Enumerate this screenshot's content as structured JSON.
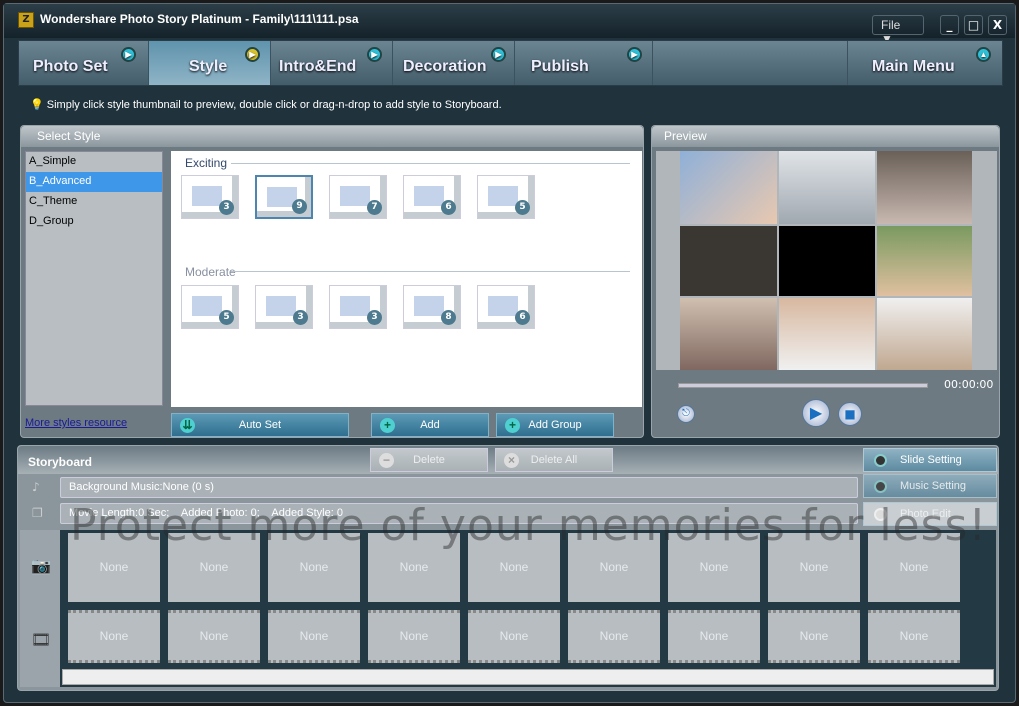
{
  "window": {
    "title": "Wondershare Photo Story Platinum - Family\\111\\111.psa",
    "file_menu": "File ▼",
    "minimize": "_",
    "maximize": "□",
    "close": "X"
  },
  "tabs": [
    {
      "label": "Photo Set",
      "active": false
    },
    {
      "label": "Style",
      "active": true
    },
    {
      "label": "Intro&End",
      "active": false
    },
    {
      "label": "Decoration",
      "active": false
    },
    {
      "label": "Publish",
      "active": false
    },
    {
      "label": "Main Menu",
      "active": false
    }
  ],
  "hint": "Simply click style thumbnail to preview, double click or drag-n-drop to add style to Storyboard.",
  "select_style": {
    "title": "Select Style",
    "categories": [
      "A_Simple",
      "B_Advanced",
      "C_Theme",
      "D_Group"
    ],
    "selected": "B_Advanced",
    "groups": [
      {
        "name": "Exciting",
        "badges": [
          "3",
          "9",
          "7",
          "6",
          "5"
        ],
        "selected_index": 1
      },
      {
        "name": "Moderate",
        "badges": [
          "5",
          "3",
          "3",
          "8",
          "6"
        ]
      }
    ],
    "more_link": "More styles resource",
    "auto_set": "Auto Set",
    "add": "Add",
    "add_group": "Add Group"
  },
  "preview": {
    "title": "Preview",
    "time": "00:00:00"
  },
  "storyboard": {
    "title": "Storyboard",
    "delete": "Delete",
    "delete_all": "Delete All",
    "slide_setting": "Slide Setting",
    "music_setting": "Music Setting",
    "photo_edit": "Photo Edit",
    "music_row": "Background Music:None (0 s)",
    "info_row": "Movie Length:0 Sec;    Added Photo: 0;    Added Style: 0",
    "photo_cells": [
      "None",
      "None",
      "None",
      "None",
      "None",
      "None",
      "None",
      "None",
      "None"
    ],
    "transition_cells": [
      "None",
      "None",
      "None",
      "None",
      "None",
      "None",
      "None",
      "None",
      "None"
    ]
  },
  "watermark": "Protect more of your memories for less!",
  "colors": {
    "accent": "#3e97e9",
    "background": "#20333d"
  }
}
